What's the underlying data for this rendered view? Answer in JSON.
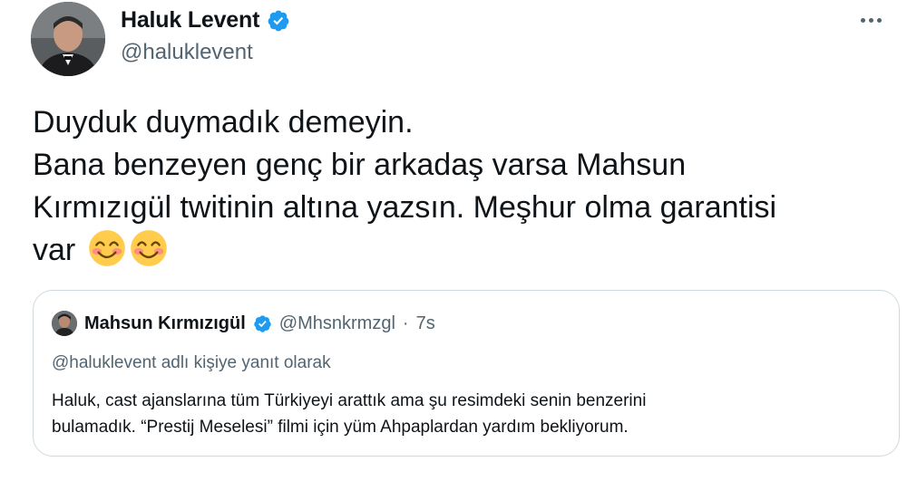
{
  "tweet": {
    "author": {
      "name": "Haluk Levent",
      "handle": "@haluklevent",
      "verified": true
    },
    "text_lines": [
      "Duyduk duymadık demeyin.",
      "Bana benzeyen genç bir arkadaş varsa Mahsun",
      "Kırmızıgül twitinin altına yazsın. Meşhur olma garantisi",
      "var"
    ],
    "emojis": [
      "smiling-face-with-smiling-eyes",
      "smiling-face-with-smiling-eyes"
    ]
  },
  "quote": {
    "author": {
      "name": "Mahsun Kırmızıgül",
      "handle": "@Mhsnkrmzgl",
      "verified": true
    },
    "separator": "·",
    "time": "7s",
    "reply_context": "@haluklevent adlı kişiye yanıt olarak",
    "text_lines": [
      "Haluk, cast ajanslarına tüm  Türkiyeyi arattık ama  şu resimdeki senin benzerini",
      "bulamadık. “Prestij Meselesi” filmi için yüm Ahpaplardan yardım bekliyorum."
    ]
  },
  "colors": {
    "text_primary": "#0f1419",
    "text_secondary": "#536471",
    "verified_blue": "#1d9bf0",
    "border": "#cfd9de"
  },
  "icons": {
    "verified": "verified-badge-icon",
    "more": "more-dots-icon"
  }
}
